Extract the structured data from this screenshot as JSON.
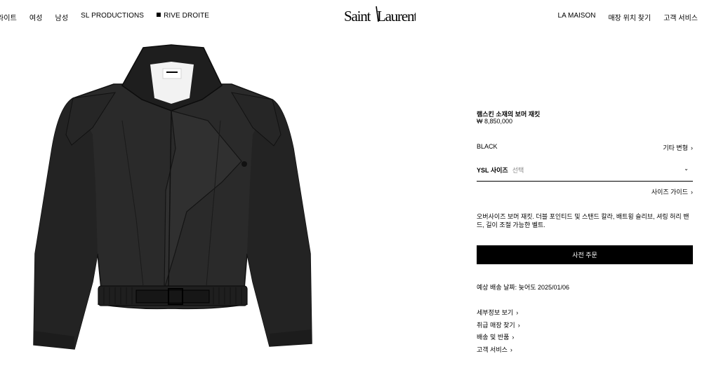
{
  "header": {
    "left_nav": [
      "라이트",
      "여성",
      "남성",
      "SL PRODUCTIONS",
      "RIVE DROITE"
    ],
    "logo_text": "SAINT LAURENT",
    "right_nav": [
      "LA MAISON",
      "매장 위치 찾기",
      "고객 서비스"
    ]
  },
  "product": {
    "title": "램스킨 소재의 보머 재킷",
    "price": "₩ 8,850,000",
    "color": "BLACK",
    "other_variants": "기타 변형",
    "size_label": "YSL 사이즈",
    "size_placeholder": "선택",
    "size_guide": "사이즈 가이드",
    "description": "오버사이즈 보머 재킷. 더블 포인티드 및 스탠드 칼라, 배트윙 슬리브, 셔링 허리 밴드, 길이 조절 가능한 벨트.",
    "order_button": "사전 주문",
    "shipping": "예상 배송 날짜: 늦어도 2025/01/06",
    "links": [
      "세부정보 보기",
      "취급 매장 찾기",
      "배송 및 반품",
      "고객 서비스"
    ]
  },
  "colors": {
    "primary": "#000000",
    "background": "#ffffff",
    "muted": "#888888"
  }
}
